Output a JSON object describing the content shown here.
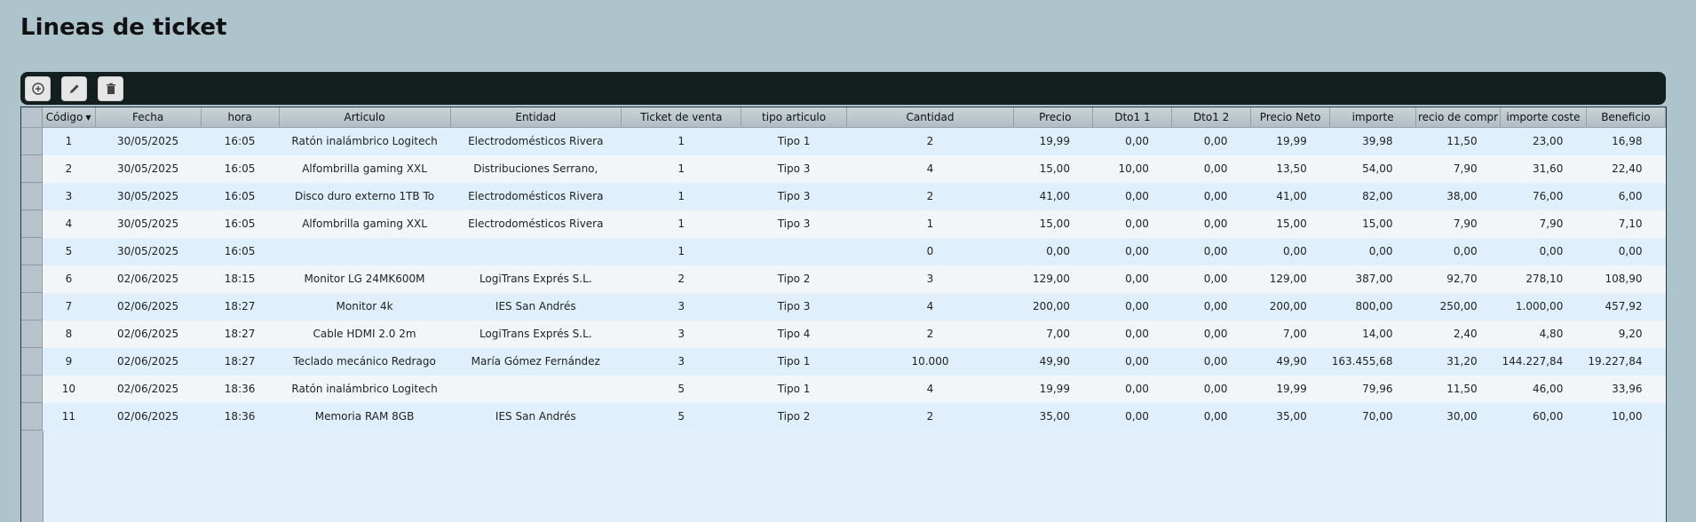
{
  "title": "Lineas de ticket",
  "toolbar": {
    "add_icon": "plus-circle-icon",
    "edit_icon": "pencil-icon",
    "delete_icon": "trash-icon"
  },
  "columns": [
    "Código",
    "Fecha",
    "hora",
    "Articulo",
    "Entidad",
    "Ticket de venta",
    "tipo articulo",
    "Cantidad",
    "Precio",
    "Dto1 1",
    "Dto1 2",
    "Precio Neto",
    "importe",
    "recio de compr",
    "importe coste",
    "Beneficio"
  ],
  "rows": [
    [
      "1",
      "30/05/2025",
      "16:05",
      "Ratón inalámbrico Logitech",
      "Electrodomésticos Rivera",
      "1",
      "Tipo 1",
      "2",
      "19,99",
      "0,00",
      "0,00",
      "19,99",
      "39,98",
      "11,50",
      "23,00",
      "16,98"
    ],
    [
      "2",
      "30/05/2025",
      "16:05",
      "Alfombrilla gaming XXL",
      "Distribuciones Serrano,",
      "1",
      "Tipo 3",
      "4",
      "15,00",
      "10,00",
      "0,00",
      "13,50",
      "54,00",
      "7,90",
      "31,60",
      "22,40"
    ],
    [
      "3",
      "30/05/2025",
      "16:05",
      "Disco duro externo 1TB To",
      "Electrodomésticos Rivera",
      "1",
      "Tipo 3",
      "2",
      "41,00",
      "0,00",
      "0,00",
      "41,00",
      "82,00",
      "38,00",
      "76,00",
      "6,00"
    ],
    [
      "4",
      "30/05/2025",
      "16:05",
      "Alfombrilla gaming XXL",
      "Electrodomésticos Rivera",
      "1",
      "Tipo 3",
      "1",
      "15,00",
      "0,00",
      "0,00",
      "15,00",
      "15,00",
      "7,90",
      "7,90",
      "7,10"
    ],
    [
      "5",
      "30/05/2025",
      "16:05",
      "",
      "",
      "1",
      "",
      "0",
      "0,00",
      "0,00",
      "0,00",
      "0,00",
      "0,00",
      "0,00",
      "0,00",
      "0,00"
    ],
    [
      "6",
      "02/06/2025",
      "18:15",
      "Monitor LG 24MK600M",
      "LogiTrans Exprés S.L.",
      "2",
      "Tipo 2",
      "3",
      "129,00",
      "0,00",
      "0,00",
      "129,00",
      "387,00",
      "92,70",
      "278,10",
      "108,90"
    ],
    [
      "7",
      "02/06/2025",
      "18:27",
      "Monitor 4k",
      "IES San Andrés",
      "3",
      "Tipo 3",
      "4",
      "200,00",
      "0,00",
      "0,00",
      "200,00",
      "800,00",
      "250,00",
      "1.000,00",
      "457,92"
    ],
    [
      "8",
      "02/06/2025",
      "18:27",
      "Cable HDMI 2.0 2m",
      "LogiTrans Exprés S.L.",
      "3",
      "Tipo 4",
      "2",
      "7,00",
      "0,00",
      "0,00",
      "7,00",
      "14,00",
      "2,40",
      "4,80",
      "9,20"
    ],
    [
      "9",
      "02/06/2025",
      "18:27",
      "Teclado mecánico Redrago",
      "María Gómez Fernández",
      "3",
      "Tipo 1",
      "10.000",
      "49,90",
      "0,00",
      "0,00",
      "49,90",
      "163.455,68",
      "31,20",
      "144.227,84",
      "19.227,84"
    ],
    [
      "10",
      "02/06/2025",
      "18:36",
      "Ratón inalámbrico Logitech",
      "",
      "5",
      "Tipo 1",
      "4",
      "19,99",
      "0,00",
      "0,00",
      "19,99",
      "79,96",
      "11,50",
      "46,00",
      "33,96"
    ],
    [
      "11",
      "02/06/2025",
      "18:36",
      "Memoria RAM 8GB",
      "IES San Andrés",
      "5",
      "Tipo 2",
      "2",
      "35,00",
      "0,00",
      "0,00",
      "35,00",
      "70,00",
      "30,00",
      "60,00",
      "10,00"
    ]
  ]
}
